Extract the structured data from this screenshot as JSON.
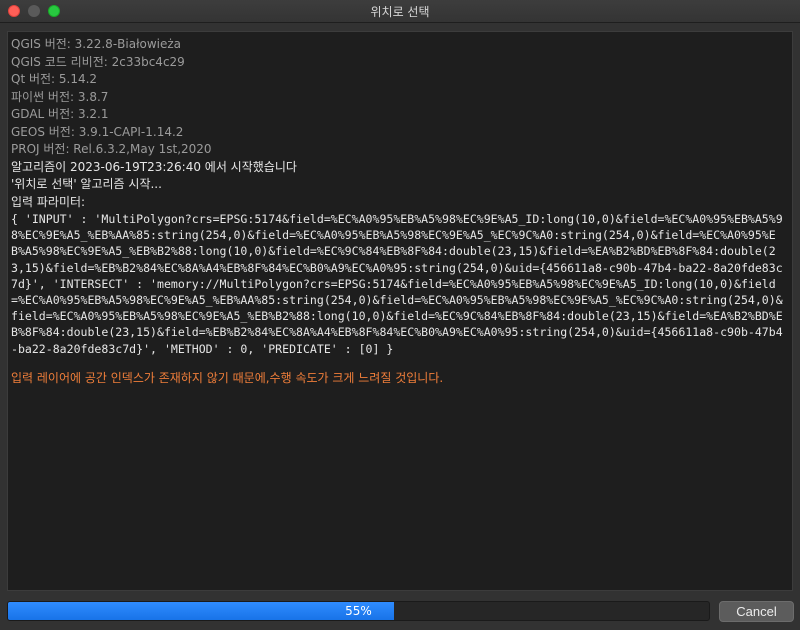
{
  "window": {
    "title": "위치로 선택"
  },
  "log": {
    "info_lines": [
      "QGIS 버전: 3.22.8-Białowieża",
      "QGIS 코드 리비전: 2c33bc4c29",
      "Qt 버전: 5.14.2",
      "파이썬 버전: 3.8.7",
      "GDAL 버전: 3.2.1",
      "GEOS 버전: 3.9.1-CAPI-1.14.2",
      "PROJ 버전: Rel.6.3.2,May 1st,2020"
    ],
    "status_lines": [
      "알고리즘이 2023-06-19T23:26:40 에서 시작했습니다",
      "'위치로 선택' 알고리즘 시작...",
      "입력 파라미터:"
    ],
    "params": "{ 'INPUT' : 'MultiPolygon?crs=EPSG:5174&field=%EC%A0%95%EB%A5%98%EC%9E%A5_ID:long(10,0)&field=%EC%A0%95%EB%A5%98%EC%9E%A5_%EB%AA%85:string(254,0)&field=%EC%A0%95%EB%A5%98%EC%9E%A5_%EC%9C%A0:string(254,0)&field=%EC%A0%95%EB%A5%98%EC%9E%A5_%EB%B2%88:long(10,0)&field=%EC%9C%84%EB%8F%84:double(23,15)&field=%EA%B2%BD%EB%8F%84:double(23,15)&field=%EB%B2%84%EC%8A%A4%EB%8F%84%EC%B0%A9%EC%A0%95:string(254,0)&uid={456611a8-c90b-47b4-ba22-8a20fde83c7d}', 'INTERSECT' : 'memory://MultiPolygon?crs=EPSG:5174&field=%EC%A0%95%EB%A5%98%EC%9E%A5_ID:long(10,0)&field=%EC%A0%95%EB%A5%98%EC%9E%A5_%EB%AA%85:string(254,0)&field=%EC%A0%95%EB%A5%98%EC%9E%A5_%EC%9C%A0:string(254,0)&field=%EC%A0%95%EB%A5%98%EC%9E%A5_%EB%B2%88:long(10,0)&field=%EC%9C%84%EB%8F%84:double(23,15)&field=%EA%B2%BD%EB%8F%84:double(23,15)&field=%EB%B2%84%EC%8A%A4%EB%8F%84%EC%B0%A9%EC%A0%95:string(254,0)&uid={456611a8-c90b-47b4-ba22-8a20fde83c7d}', 'METHOD' : 0, 'PREDICATE' : [0] }",
    "warning": "입력 레이어에 공간 인덱스가 존재하지 않기 때문에,수행 속도가 크게 느려질 것입니다."
  },
  "progress": {
    "value": 0.55,
    "label": "55%"
  },
  "buttons": {
    "cancel_label": "Cancel"
  },
  "colors": {
    "accent": "#1873e8",
    "warning": "#f07e3a"
  }
}
